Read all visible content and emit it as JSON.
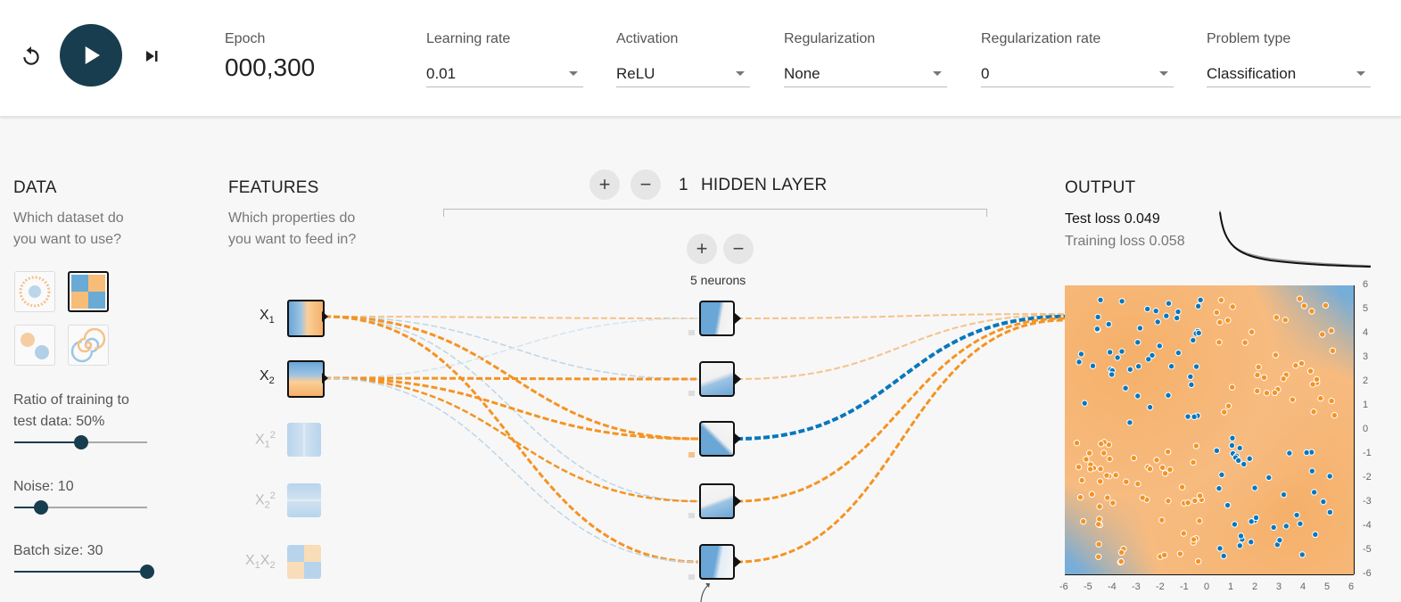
{
  "toolbar": {
    "epoch_label": "Epoch",
    "epoch_value": "000,300",
    "learning_rate": {
      "label": "Learning rate",
      "value": "0.01"
    },
    "activation": {
      "label": "Activation",
      "value": "ReLU"
    },
    "regularization": {
      "label": "Regularization",
      "value": "None"
    },
    "regularization_rate": {
      "label": "Regularization rate",
      "value": "0"
    },
    "problem_type": {
      "label": "Problem type",
      "value": "Classification"
    },
    "icons": [
      "reset-icon",
      "play-icon",
      "step-icon"
    ]
  },
  "data_panel": {
    "title": "DATA",
    "subtitle_line1": "Which dataset do",
    "subtitle_line2": "you want to use?",
    "ratio_line1": "Ratio of training to",
    "ratio_line2": "test data:  50%",
    "ratio_value": 0.5,
    "noise_label": "Noise:  10",
    "noise_value": 0.2,
    "batch_label": "Batch size:  30",
    "batch_value": 1.0
  },
  "features_panel": {
    "title": "FEATURES",
    "subtitle_line1": "Which properties do",
    "subtitle_line2": "you want to feed in?",
    "features": [
      {
        "base": "X",
        "sub": "1",
        "sup": "",
        "active": true
      },
      {
        "base": "X",
        "sub": "2",
        "sup": "",
        "active": true
      },
      {
        "base": "X",
        "sub": "1",
        "sup": "2",
        "active": false
      },
      {
        "base": "X",
        "sub": "2",
        "sup": "2",
        "active": false
      },
      {
        "base": "X",
        "sub": "1",
        "base2": "X",
        "sub2": "2",
        "active": false
      }
    ]
  },
  "hidden": {
    "count": "1",
    "title": "HIDDEN LAYER",
    "add": "+",
    "remove": "−",
    "neurons_label": "5 neurons"
  },
  "output": {
    "title": "OUTPUT",
    "test_loss": "Test loss 0.049",
    "training_loss": "Training loss 0.058",
    "y_ticks": [
      "6",
      "5",
      "4",
      "3",
      "2",
      "1",
      "0",
      "-1",
      "-2",
      "-3",
      "-4",
      "-5",
      "-6"
    ],
    "x_ticks": [
      "-6",
      "-5",
      "-4",
      "-3",
      "-2",
      "-1",
      "0",
      "1",
      "2",
      "3",
      "4",
      "5",
      "6"
    ]
  },
  "colors": {
    "orange": "#f59322",
    "blue": "#0877bd",
    "dark": "#183d4e"
  }
}
